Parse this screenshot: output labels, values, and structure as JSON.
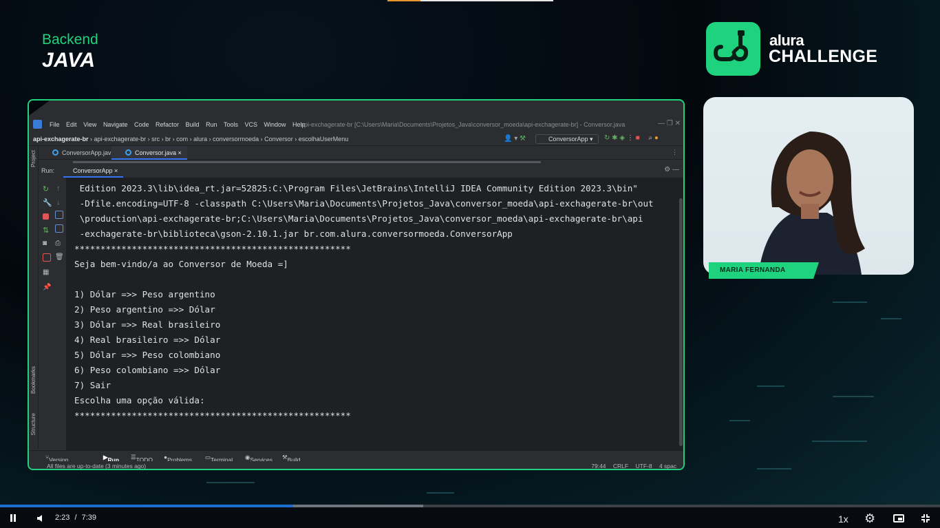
{
  "course": {
    "subtitle": "Backend",
    "title": "JAVA"
  },
  "brand": {
    "name": "alura",
    "product": "CHALLENGE",
    "accent": "#1fd27d"
  },
  "presenter": {
    "name": "MARIA FERNANDA"
  },
  "ide": {
    "menu": [
      "File",
      "Edit",
      "View",
      "Navigate",
      "Code",
      "Refactor",
      "Build",
      "Run",
      "Tools",
      "VCS",
      "Window",
      "Help"
    ],
    "window_title": "api-exchagerate-br [C:\\Users\\Maria\\Documents\\Projetos_Java\\conversor_moeda\\api-exchagerate-br] - Conversor.java",
    "breadcrumbs": [
      "api-exchagerate-br",
      "api-exchagerate-br",
      "src",
      "br",
      "com",
      "alura",
      "conversormoeda",
      "Conversor",
      "escolhaUserMenu"
    ],
    "run_config": "ConversorApp",
    "tabs": [
      {
        "label": "ConversorApp.java"
      },
      {
        "label": "Conversor.java"
      }
    ],
    "side_labels": {
      "project": "Project",
      "bookmarks": "Bookmarks",
      "structure": "Structure"
    },
    "run_label": "Run:",
    "run_tab": "ConversorApp",
    "console_lines": [
      " Edition 2023.3\\lib\\idea_rt.jar=52825:C:\\Program Files\\JetBrains\\IntelliJ IDEA Community Edition 2023.3\\bin\"",
      " -Dfile.encoding=UTF-8 -classpath C:\\Users\\Maria\\Documents\\Projetos_Java\\conversor_moeda\\api-exchagerate-br\\out",
      " \\production\\api-exchagerate-br;C:\\Users\\Maria\\Documents\\Projetos_Java\\conversor_moeda\\api-exchagerate-br\\api",
      " -exchagerate-br\\biblioteca\\gson-2.10.1.jar br.com.alura.conversormoeda.ConversorApp",
      "*****************************************************",
      "Seja bem-vindo/a ao Conversor de Moeda =]",
      "",
      "1) Dólar =>> Peso argentino",
      "2) Peso argentino =>> Dólar",
      "3) Dólar =>> Real brasileiro",
      "4) Real brasileiro =>> Dólar",
      "5) Dólar =>> Peso colombiano",
      "6) Peso colombiano =>> Dólar",
      "7) Sair",
      "Escolha uma opção válida:",
      "*****************************************************"
    ],
    "bottom_tabs": [
      "Version Control",
      "Run",
      "TODO",
      "Problems",
      "Terminal",
      "Services",
      "Build"
    ],
    "status": {
      "message": "All files are up-to-date (3 minutes ago)",
      "position": "79:44",
      "line_ending": "CRLF",
      "encoding": "UTF-8",
      "indent": "4 spac"
    }
  },
  "player": {
    "current_time": "2:23",
    "separator": "/",
    "duration": "7:39",
    "speed": "1x",
    "progress": 0.312,
    "buffered": 0.45
  }
}
